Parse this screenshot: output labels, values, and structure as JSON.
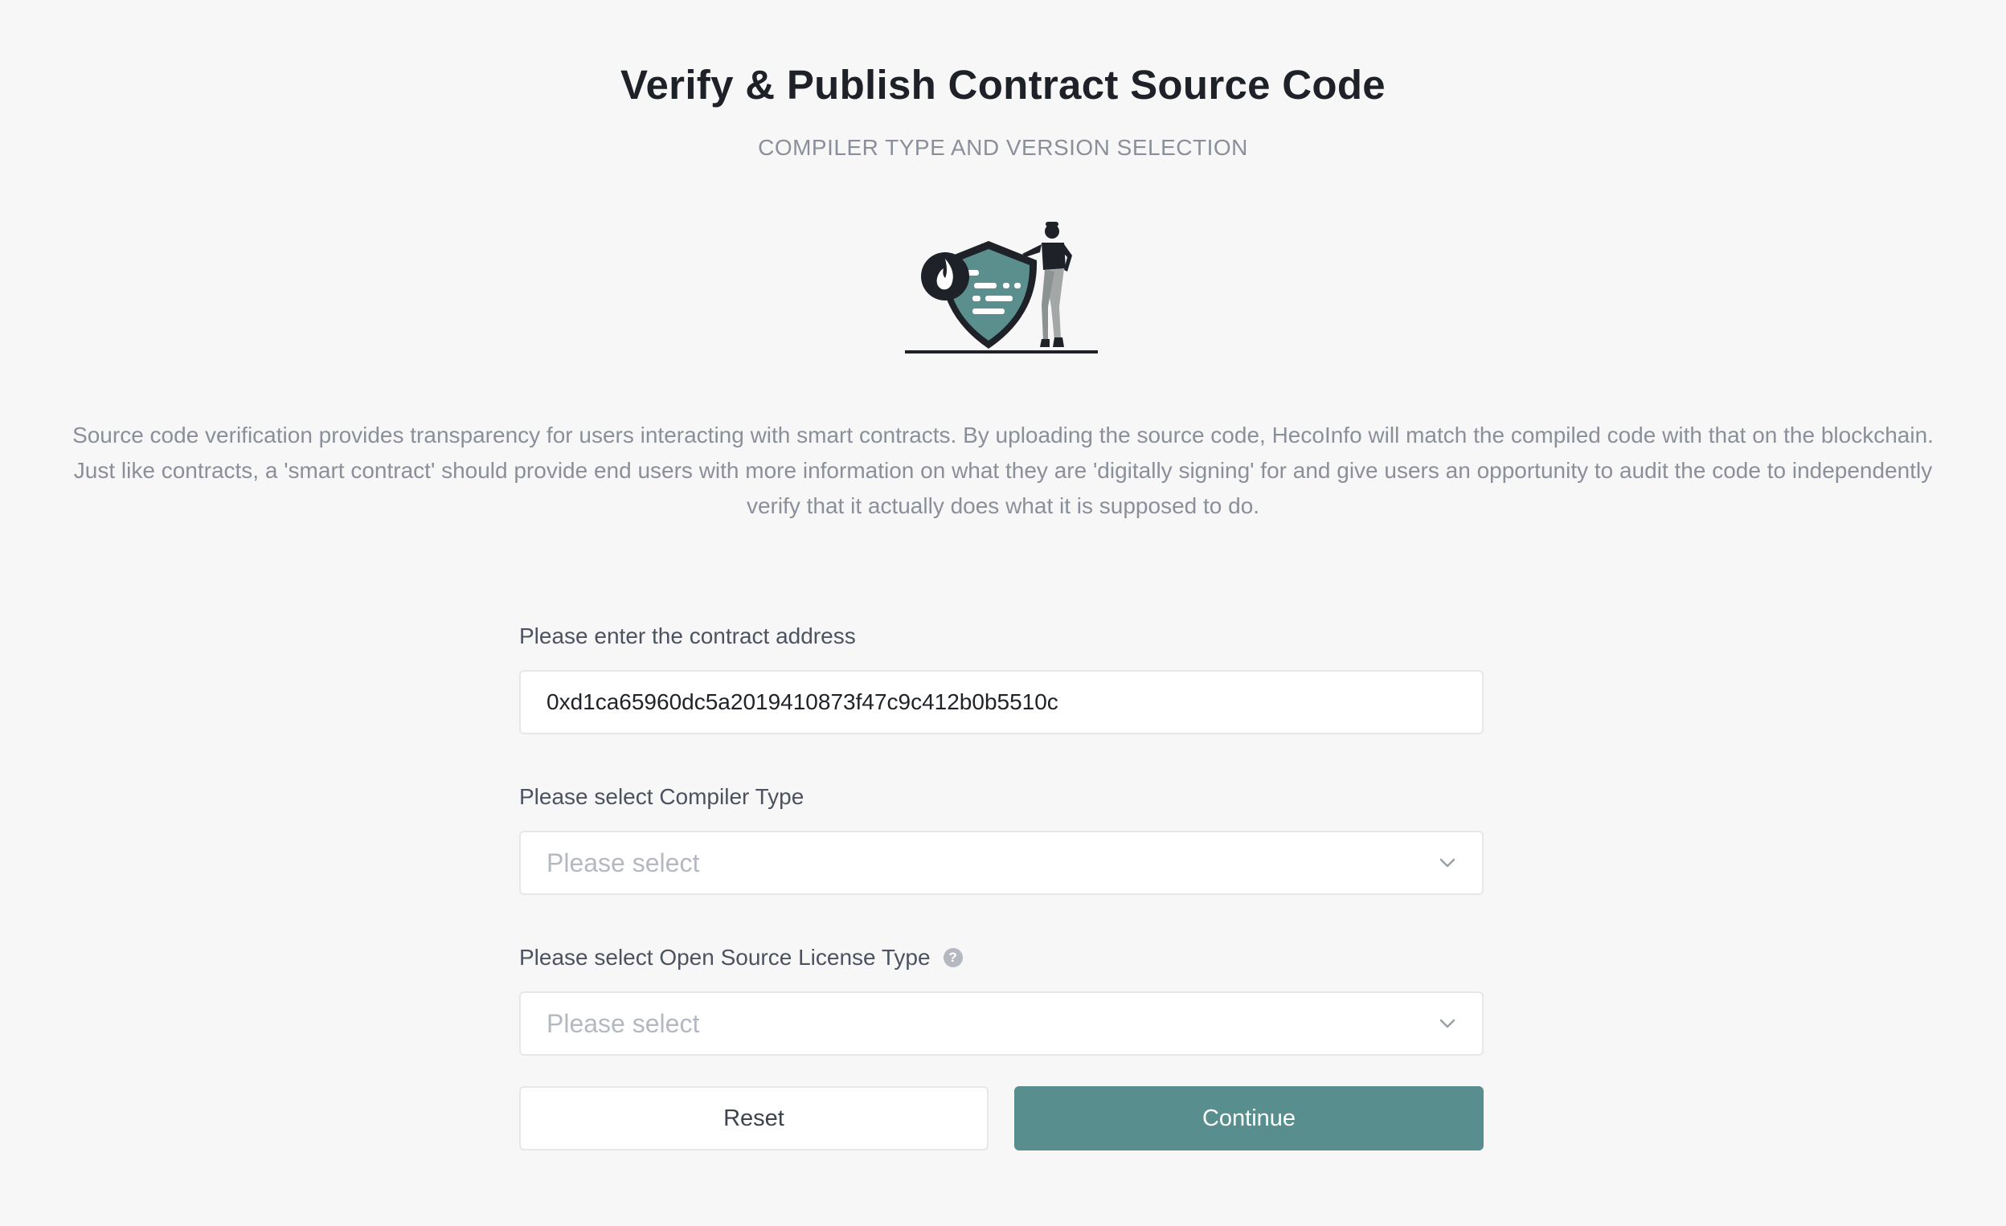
{
  "header": {
    "title": "Verify & Publish Contract Source Code",
    "subtitle": "COMPILER TYPE AND VERSION SELECTION"
  },
  "illustration": {
    "icon": "shield-with-person-illustration"
  },
  "description": "Source code verification provides transparency for users interacting with smart contracts. By uploading the source code, HecoInfo will match the compiled code with that on the blockchain. Just like contracts, a 'smart contract' should provide end users with more information on what they are 'digitally signing' for and give users an opportunity to audit the code to independently verify that it actually does what it is supposed to do.",
  "form": {
    "address": {
      "label": "Please enter the contract address",
      "value": "0xd1ca65960dc5a2019410873f47c9c412b0b5510c"
    },
    "compiler": {
      "label": "Please select Compiler Type",
      "placeholder": "Please select"
    },
    "license": {
      "label": "Please select Open Source License Type",
      "placeholder": "Please select"
    }
  },
  "buttons": {
    "reset": "Reset",
    "continue": "Continue"
  },
  "colors": {
    "accent": "#588f8e",
    "background": "#f7f7f7"
  }
}
